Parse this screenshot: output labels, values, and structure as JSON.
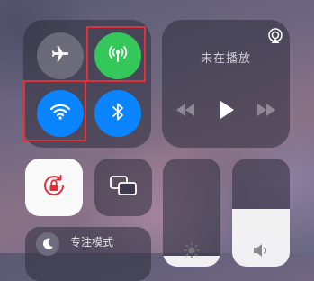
{
  "control_center": {
    "connectivity": {
      "airplane_mode": {
        "icon": "airplane-icon",
        "state": "off"
      },
      "cellular_data": {
        "icon": "cellular-antenna-icon",
        "state": "on",
        "color": "#34c759"
      },
      "wifi": {
        "icon": "wifi-icon",
        "state": "on",
        "color": "#0a84ff"
      },
      "bluetooth": {
        "icon": "bluetooth-icon",
        "state": "on",
        "color": "#0a84ff"
      }
    },
    "media": {
      "title": "未在播放",
      "airplay_icon": "airplay-icon",
      "controls": [
        "rewind-icon",
        "play-icon",
        "fast-forward-icon"
      ]
    },
    "orientation_lock": {
      "icon": "rotation-lock-icon",
      "state": "on",
      "color": "#e0303a"
    },
    "screen_mirroring": {
      "icon": "screen-mirroring-icon"
    },
    "brightness": {
      "icon": "sun-icon",
      "level": 0.1
    },
    "volume": {
      "icon": "speaker-icon",
      "level": 0.53
    },
    "focus": {
      "label": "专注模式",
      "icon": "moon-icon"
    }
  },
  "annotations": {
    "highlight_color": "#e0303a",
    "highlighted": [
      "cellular_data",
      "wifi"
    ]
  }
}
